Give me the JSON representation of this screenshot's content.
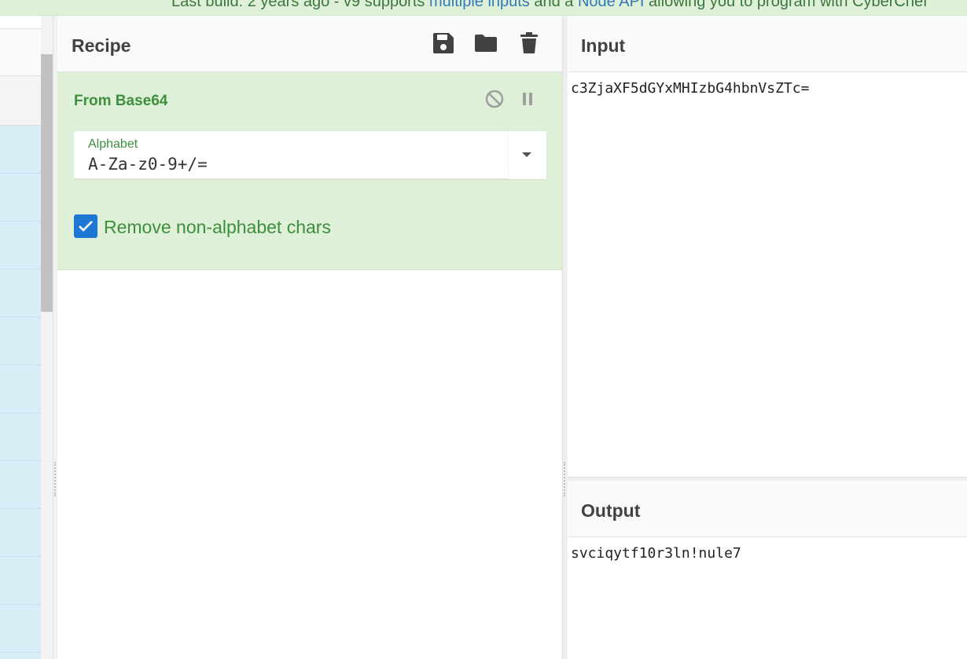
{
  "banner": {
    "text_before": "Last build: 2 years ago - v9 supports ",
    "link1": "multiple inputs",
    "text_mid": " and a ",
    "link2": "Node API",
    "text_after": " allowing you to program with CyberChef"
  },
  "recipe": {
    "title": "Recipe",
    "icons": [
      "save-icon",
      "folder-icon",
      "trash-icon"
    ],
    "operation": {
      "name": "From Base64",
      "icons": [
        "disable-icon",
        "pause-icon"
      ],
      "argument": {
        "label": "Alphabet",
        "value": "A-Za-z0-9+/="
      },
      "checkbox": {
        "label": "Remove non-alphabet chars",
        "checked": true
      }
    }
  },
  "input": {
    "title": "Input",
    "value": "c3ZjaXF5dGYxMHIzbG4hbnVsZTc="
  },
  "output": {
    "title": "Output",
    "value": "svciqytf10r3ln!nule7"
  },
  "colors": {
    "banner_bg": "#dff0d8",
    "operation_bg": "#dff0d8",
    "operation_text": "#3c8f3c",
    "checkbox_accent": "#1f77d4",
    "ops_list_bg": "#d9edf7"
  }
}
